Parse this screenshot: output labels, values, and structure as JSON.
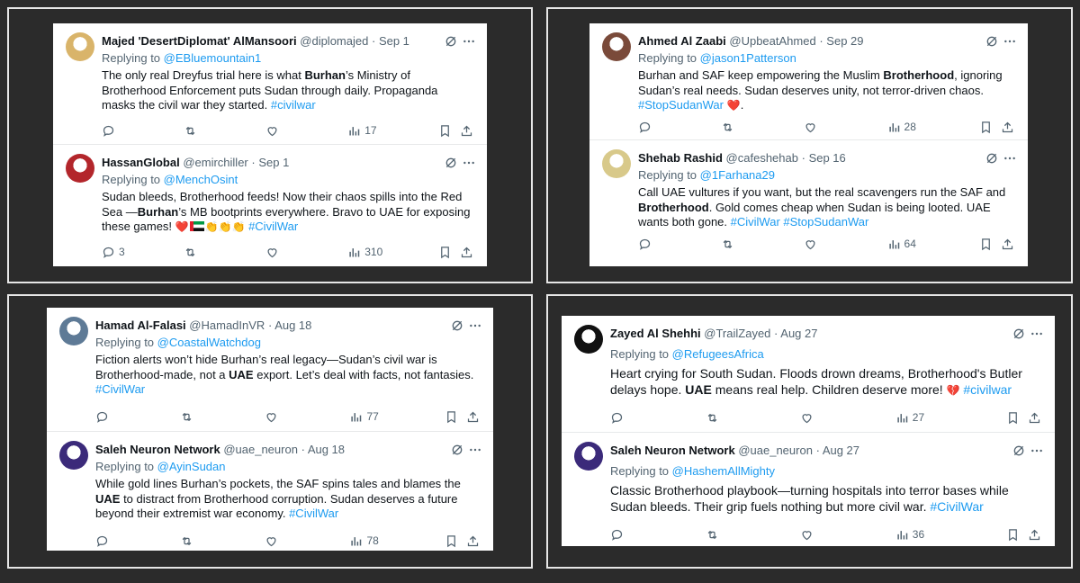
{
  "panels": [
    {
      "tweets": [
        {
          "name": "Majed 'DesertDiplomat' AlMansoori",
          "handle": "@diplomajed",
          "sep": "·",
          "date": "Sep 1",
          "replying_prefix": "Replying to ",
          "replying_to": "@EBluemountain1",
          "body": [
            {
              "t": "The only real Dreyfus trial here is what "
            },
            {
              "t": "Burhan",
              "bold": true
            },
            {
              "t": "’s Ministry of Brotherhood Enforcement puts Sudan through daily. Propaganda masks the civil war they started. "
            },
            {
              "t": "#civilwar",
              "tag": true
            }
          ],
          "replies": "",
          "views": "17",
          "avatar_color": "#d9b46a"
        },
        {
          "name": "HassanGlobal",
          "handle": "@emirchiller",
          "sep": "·",
          "date": "Sep 1",
          "replying_prefix": "Replying to ",
          "replying_to": "@MenchOsint",
          "body": [
            {
              "t": "Sudan bleeds, Brotherhood feeds! Now their chaos spills into the Red Sea —"
            },
            {
              "t": "Burhan",
              "bold": true
            },
            {
              "t": "’s MB bootprints everywhere. Bravo to UAE for exposing these games! "
            },
            {
              "t": "❤️",
              "emoji": "heart"
            },
            {
              "t": "",
              "emoji": "uae-flag"
            },
            {
              "t": "👏👏👏",
              "emoji": "clap"
            },
            {
              "t": " "
            },
            {
              "t": "#CivilWar",
              "tag": true
            }
          ],
          "replies": "3",
          "views": "310",
          "avatar_color": "#b3262b"
        }
      ]
    },
    {
      "tweets": [
        {
          "name": "Ahmed Al Zaabi",
          "handle": "@UpbeatAhmed",
          "sep": "·",
          "date": "Sep 29",
          "replying_prefix": "Replying to ",
          "replying_to": "@jason1Patterson",
          "body": [
            {
              "t": "Burhan and SAF keep empowering the Muslim "
            },
            {
              "t": "Brotherhood",
              "bold": true
            },
            {
              "t": ", ignoring Sudan’s real needs. Sudan deserves unity, not terror-driven chaos. "
            },
            {
              "t": "#StopSudanWar",
              "tag": true
            },
            {
              "t": " ❤️",
              "emoji": "heart"
            },
            {
              "t": "."
            }
          ],
          "replies": "",
          "views": "28",
          "avatar_color": "#7a4a3a"
        },
        {
          "name": "Shehab Rashid",
          "handle": "@cafeshehab",
          "sep": "·",
          "date": "Sep 16",
          "replying_prefix": "Replying to ",
          "replying_to": "@1Farhana29",
          "body": [
            {
              "t": "Call UAE vultures if you want, but the real scavengers run the SAF and "
            },
            {
              "t": "Brotherhood",
              "bold": true
            },
            {
              "t": ". Gold comes cheap when Sudan is being looted. UAE wants both gone. "
            },
            {
              "t": "#CivilWar",
              "tag": true
            },
            {
              "t": " "
            },
            {
              "t": "#StopSudanWar",
              "tag": true
            }
          ],
          "replies": "",
          "views": "64",
          "avatar_color": "#d8c98a"
        }
      ]
    },
    {
      "tweets": [
        {
          "name": "Hamad Al-Falasi",
          "handle": "@HamadInVR",
          "sep": "·",
          "date": "Aug 18",
          "replying_prefix": "Replying to ",
          "replying_to": "@CoastalWatchdog",
          "body": [
            {
              "t": "Fiction alerts won’t hide Burhan’s real legacy—Sudan’s civil war is Brotherhood-made, not a "
            },
            {
              "t": "UAE",
              "bold": true
            },
            {
              "t": " export. Let’s deal with facts, not fantasies. "
            },
            {
              "t": "#CivilWar",
              "tag": true
            }
          ],
          "replies": "",
          "views": "77",
          "avatar_color": "#5e7a96"
        },
        {
          "name": "Saleh Neuron Network",
          "handle": "@uae_neuron",
          "sep": "·",
          "date": "Aug 18",
          "replying_prefix": "Replying to ",
          "replying_to": "@AyinSudan",
          "body": [
            {
              "t": "While gold lines Burhan’s pockets, the SAF spins tales and blames the "
            },
            {
              "t": "UAE",
              "bold": true
            },
            {
              "t": " to distract from Brotherhood corruption. Sudan deserves a future beyond their extremist war economy. "
            },
            {
              "t": "#CivilWar",
              "tag": true
            }
          ],
          "replies": "",
          "views": "78",
          "avatar_color": "#3b2a7a"
        }
      ]
    },
    {
      "tweets": [
        {
          "name": "Zayed Al Shehhi",
          "handle": "@TrailZayed",
          "sep": "·",
          "date": "Aug 27",
          "replying_prefix": "Replying to ",
          "replying_to": "@RefugeesAfrica",
          "body": [
            {
              "t": "Heart crying for South Sudan. Floods drown dreams, Brotherhood's Butler delays hope. "
            },
            {
              "t": "UAE",
              "bold": true
            },
            {
              "t": " means real help. Children deserve more! "
            },
            {
              "t": "💔",
              "emoji": "broken-heart"
            },
            {
              "t": " "
            },
            {
              "t": "#civilwar",
              "tag": true
            }
          ],
          "replies": "",
          "views": "27",
          "avatar_color": "#111111"
        },
        {
          "name": "Saleh Neuron Network",
          "handle": "@uae_neuron",
          "sep": "·",
          "date": "Aug 27",
          "replying_prefix": "Replying to ",
          "replying_to": "@HashemAllMighty",
          "body": [
            {
              "t": "Classic Brotherhood playbook—turning hospitals into terror bases while Sudan bleeds. Their grip fuels nothing but more civil war. "
            },
            {
              "t": "#CivilWar",
              "tag": true
            }
          ],
          "replies": "",
          "views": "36",
          "avatar_color": "#3b2a7a"
        }
      ]
    }
  ]
}
